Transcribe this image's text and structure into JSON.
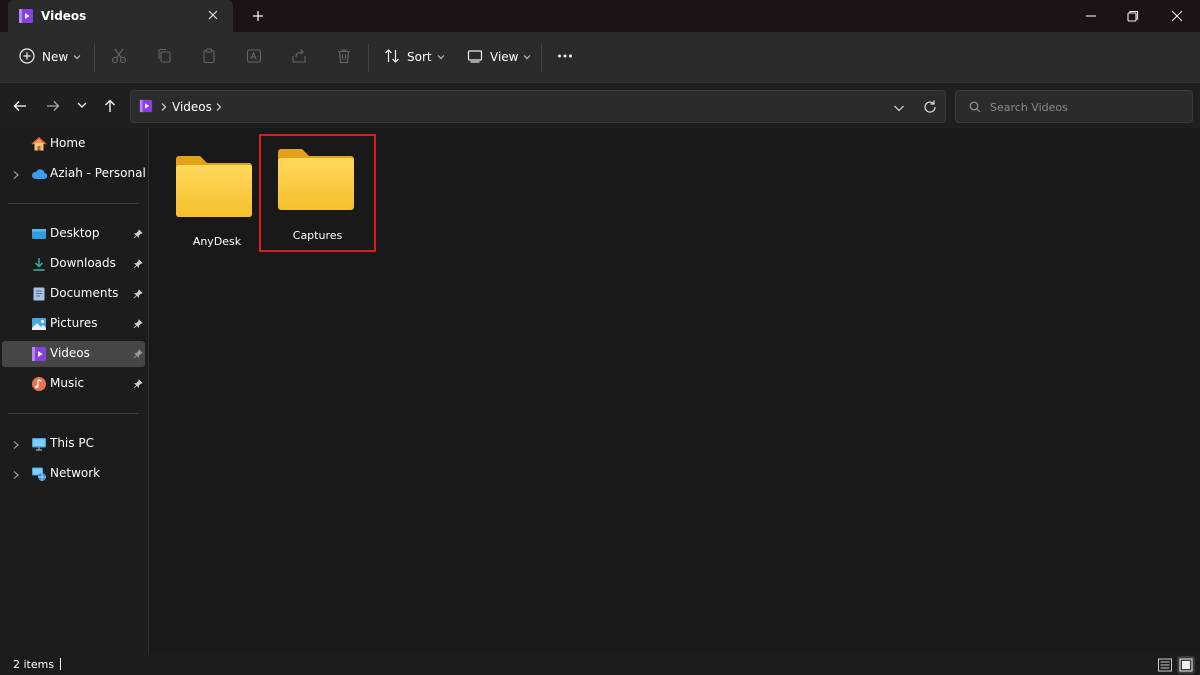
{
  "tab": {
    "title": "Videos"
  },
  "toolbar": {
    "new_label": "New",
    "sort_label": "Sort",
    "view_label": "View"
  },
  "address": {
    "breadcrumb": "Videos"
  },
  "search": {
    "placeholder": "Search Videos"
  },
  "sidebar": {
    "items": [
      {
        "label": "Home",
        "icon": "home-icon"
      },
      {
        "label": "Aziah - Personal",
        "icon": "onedrive-cloud-icon"
      },
      {
        "label": "Desktop",
        "icon": "desktop-folder-icon",
        "pinned": true
      },
      {
        "label": "Downloads",
        "icon": "downloads-icon",
        "pinned": true
      },
      {
        "label": "Documents",
        "icon": "documents-icon",
        "pinned": true
      },
      {
        "label": "Pictures",
        "icon": "pictures-icon",
        "pinned": true
      },
      {
        "label": "Videos",
        "icon": "videos-icon",
        "pinned": true,
        "selected": true
      },
      {
        "label": "Music",
        "icon": "music-icon",
        "pinned": true
      },
      {
        "label": "This PC",
        "icon": "this-pc-icon"
      },
      {
        "label": "Network",
        "icon": "network-icon"
      }
    ]
  },
  "folders": [
    {
      "name": "AnyDesk"
    },
    {
      "name": "Captures",
      "highlighted": true
    }
  ],
  "status": {
    "item_count": "2 items"
  },
  "colors": {
    "folder": "#f8c73a",
    "highlight_box": "#d91c24",
    "accent_purple": "#8a3ee0",
    "selected_item_bg": "#464646"
  }
}
